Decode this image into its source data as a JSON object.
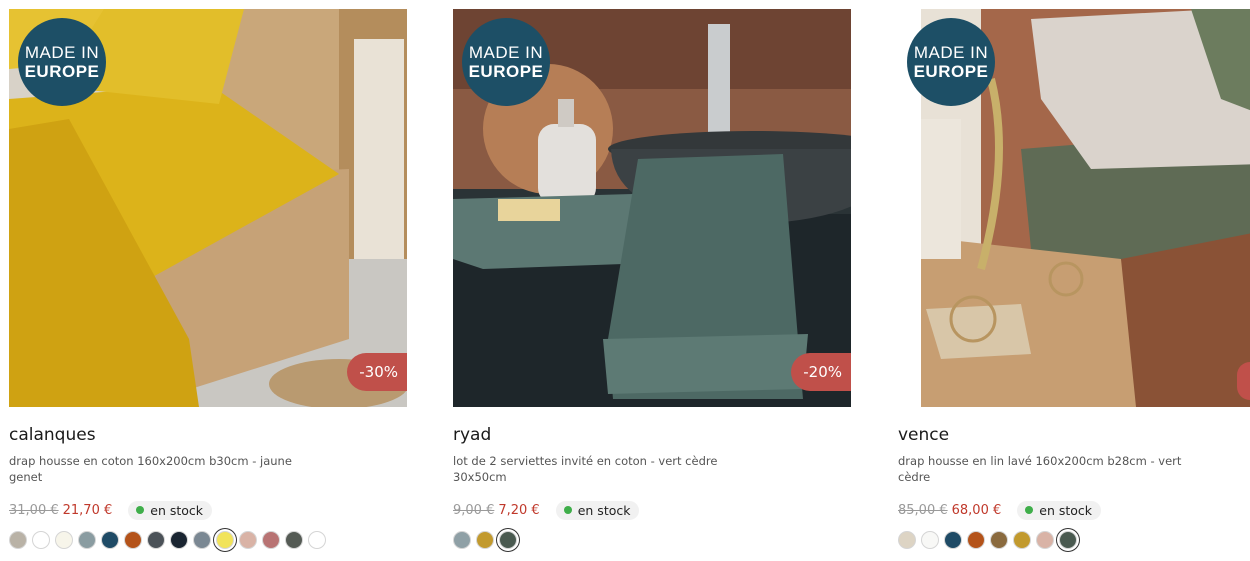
{
  "made_in": {
    "line1": "MADE IN",
    "line2": "EUROPE"
  },
  "stock_label": "en stock",
  "colors": {
    "badge": "#1d4f66",
    "discount": "#c0504a",
    "sale_price": "#c0392b",
    "stock_dot": "#3fae4a"
  },
  "products": [
    {
      "title": "calanques",
      "description": "drap housse en coton 160x200cm b30cm - jaune genet",
      "old_price": "31,00 €",
      "new_price": "21,70 €",
      "discount": "-30%",
      "swatches": [
        "#b9b2a6",
        "#ffffff",
        "#f7f5ea",
        "#8a9ca1",
        "#1f4b66",
        "#b4531a",
        "#4b5258",
        "#1a2531",
        "#7b8893",
        "#f1e35a",
        "#d9b3a6",
        "#b87373",
        "#555b55",
        "#ffffff"
      ],
      "selected_swatch": 9
    },
    {
      "title": "ryad",
      "description": "lot de 2 serviettes invité en coton - vert cèdre 30x50cm",
      "old_price": "9,00 €",
      "new_price": "7,20 €",
      "discount": "-20%",
      "swatches": [
        "#8fa0a6",
        "#c29a2e",
        "#4a5a50"
      ],
      "selected_swatch": 2
    },
    {
      "title": "vence",
      "description": "drap housse en lin lavé 160x200cm b28cm - vert cèdre",
      "old_price": "85,00 €",
      "new_price": "68,00 €",
      "discount": "",
      "swatches": [
        "#ddd4c4",
        "#f8f8f6",
        "#1f4b66",
        "#b4531a",
        "#8a6a3e",
        "#c29a2e",
        "#d9b3a6",
        "#4a5a50"
      ],
      "selected_swatch": 7
    }
  ]
}
